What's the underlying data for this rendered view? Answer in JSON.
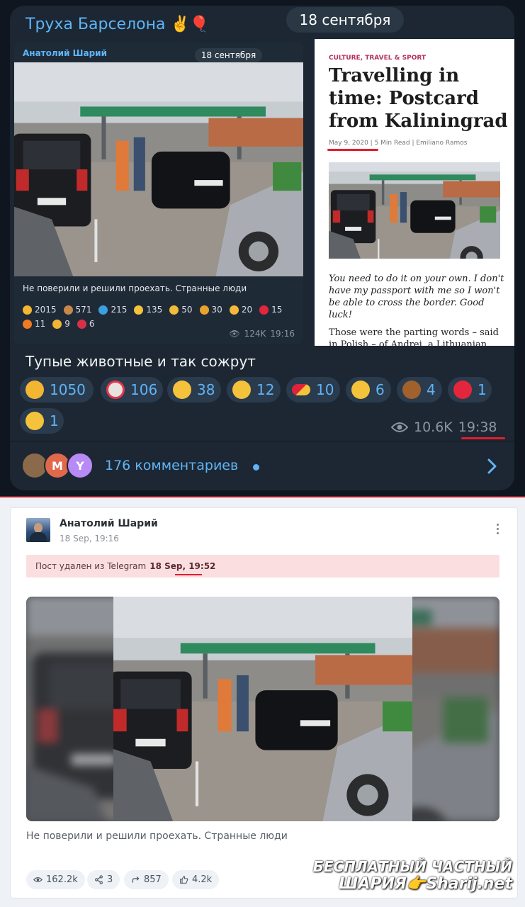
{
  "telegram": {
    "channel_name": "Труха Барселона ✌️🎈",
    "date_pill": "18 сентября",
    "forward": {
      "author": "Анатолий Шарий",
      "date_pill": "18 сентября",
      "caption": "Не поверили и решили проехать. Странные люди",
      "reactions": [
        {
          "count": "2015",
          "color": "#f2b632"
        },
        {
          "count": "571",
          "color": "#c8874a"
        },
        {
          "count": "215",
          "color": "#3aa0e0"
        },
        {
          "count": "135",
          "color": "#f5c23b"
        },
        {
          "count": "50",
          "color": "#f0bd3a"
        },
        {
          "count": "30",
          "color": "#e9a22c"
        },
        {
          "count": "20",
          "color": "#f4b93a"
        },
        {
          "count": "15",
          "color": "#e3263b"
        },
        {
          "count": "11",
          "color": "#f07a22"
        },
        {
          "count": "9",
          "color": "#f3b533"
        },
        {
          "count": "6",
          "color": "#d9304a"
        }
      ],
      "views": "124K",
      "time": "19:16"
    },
    "article": {
      "category": "CULTURE, TRAVEL & SPORT",
      "title": "Travelling in time: Postcard from Kaliningrad",
      "meta": "May 9, 2020  |  5 Min Read  |  Emiliano Ramos",
      "quote": "You need to do it on your own. I don't have my passport with me so I won't be able to cross the border. Good luck!",
      "body": "Those were the parting words – said in Polish – of Andrei, a Lithuanian"
    },
    "message_text": "Тупые животные и так сожрут",
    "reactions": [
      {
        "count": "1050",
        "color": "#f2b632",
        "icon": "rofl-emoji"
      },
      {
        "count": "106",
        "color": "#e9e3e0",
        "icon": "clown-emoji"
      },
      {
        "count": "38",
        "color": "#f5c23b",
        "icon": "grin-emoji"
      },
      {
        "count": "12",
        "color": "#f5c23b",
        "icon": "clap-emoji"
      },
      {
        "count": "10",
        "color": "#e0223a",
        "icon": "pill-emoji"
      },
      {
        "count": "6",
        "color": "#f5c23b",
        "icon": "thumbs-up-emoji"
      },
      {
        "count": "4",
        "color": "#a0612c",
        "icon": "poop-emoji"
      },
      {
        "count": "1",
        "color": "#e3263b",
        "icon": "heart-emoji"
      },
      {
        "count": "1",
        "color": "#f5c23b",
        "icon": "scream-emoji"
      }
    ],
    "views": "10.6K",
    "time": "19:38",
    "avatars": [
      {
        "letter": "",
        "color": "#8a6a4a"
      },
      {
        "letter": "M",
        "color": "#e0684b"
      },
      {
        "letter": "Y",
        "color": "#b78af5"
      }
    ],
    "comments": "176 комментариев"
  },
  "web": {
    "author": "Анатолий Шарий",
    "time": "18 Sep, 19:16",
    "deleted_notice": "Пост удален из Telegram",
    "deleted_time": "18 Sep, 19:52",
    "caption": "Не поверили и решили проехать. Странные люди",
    "stats": {
      "views": "162.2k",
      "shares": "3",
      "reposts": "857",
      "likes": "4.2k"
    }
  },
  "watermark": {
    "line1": "БЕСПЛАТНЫЙ ЧАСТНЫЙ",
    "line2": "ШАРИЯ👉Sharij.net"
  },
  "colors": {
    "telegram_bg": "#1c2733",
    "telegram_accent": "#5eb5f7",
    "highlight_underline": "#e21d2c",
    "deleted_banner": "#fbdfe0"
  }
}
